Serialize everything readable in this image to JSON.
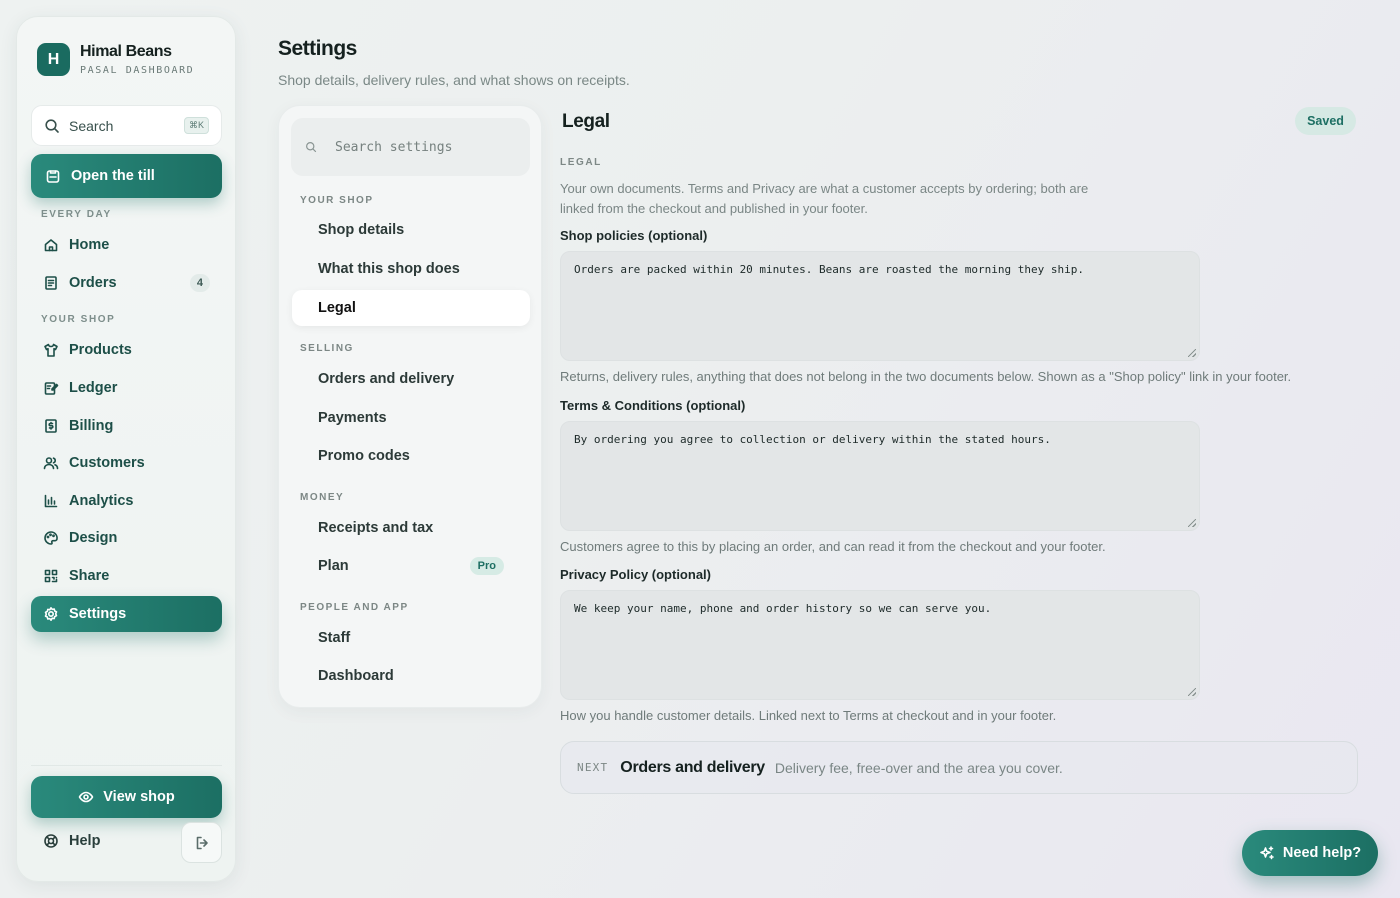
{
  "brand": {
    "logo_letter": "H",
    "name": "Himal Beans",
    "subtitle": "PASAL DASHBOARD"
  },
  "sidebar": {
    "search_label": "Search",
    "search_shortcut": "⌘K",
    "till_button": "Open the till",
    "section_everyday": "EVERY DAY",
    "section_shop": "YOUR SHOP",
    "items": [
      {
        "label": "Home",
        "icon": "home-icon"
      },
      {
        "label": "Orders",
        "icon": "receipt-icon",
        "badge": "4"
      },
      {
        "label": "Products",
        "icon": "shirt-icon"
      },
      {
        "label": "Ledger",
        "icon": "ledger-icon"
      },
      {
        "label": "Billing",
        "icon": "dollar-doc-icon"
      },
      {
        "label": "Customers",
        "icon": "users-icon"
      },
      {
        "label": "Analytics",
        "icon": "bar-chart-icon"
      },
      {
        "label": "Design",
        "icon": "palette-icon"
      },
      {
        "label": "Share",
        "icon": "qr-icon"
      },
      {
        "label": "Settings",
        "icon": "gear-icon",
        "active": true
      }
    ],
    "view_shop": "View shop",
    "help": "Help"
  },
  "header": {
    "title": "Settings",
    "subtitle": "Shop details, delivery rules, and what shows on receipts."
  },
  "settings_nav": {
    "search_placeholder": "Search settings",
    "sections": [
      {
        "label": "YOUR SHOP",
        "items": [
          "Shop details",
          "What this shop does",
          "Legal"
        ]
      },
      {
        "label": "SELLING",
        "items": [
          "Orders and delivery",
          "Payments",
          "Promo codes"
        ]
      },
      {
        "label": "MONEY",
        "items": [
          "Receipts and tax",
          "Plan"
        ]
      },
      {
        "label": "PEOPLE AND APP",
        "items": [
          "Staff",
          "Dashboard"
        ]
      }
    ],
    "active_item": "Legal",
    "plan_badge": "Pro"
  },
  "panel": {
    "title": "Legal",
    "status": "Saved",
    "caption": "LEGAL",
    "description": "Your own documents. Terms and Privacy are what a customer accepts by ordering; both are linked from the checkout and published in your footer.",
    "fields": [
      {
        "label": "Shop policies (optional)",
        "value": "Orders are packed within 20 minutes. Beans are roasted the morning they ship.",
        "help": "Returns, delivery rules, anything that does not belong in the two documents below. Shown as a \"Shop policy\" link in your footer."
      },
      {
        "label": "Terms & Conditions (optional)",
        "value": "By ordering you agree to collection or delivery within the stated hours.",
        "help": "Customers agree to this by placing an order, and can read it from the checkout and your footer."
      },
      {
        "label": "Privacy Policy (optional)",
        "value": "We keep your name, phone and order history so we can serve you.",
        "help": "How you handle customer details. Linked next to Terms at checkout and in your footer."
      }
    ],
    "next": {
      "tag": "NEXT",
      "title": "Orders and delivery",
      "description": "Delivery fee, free-over and the area you cover."
    }
  },
  "need_help": "Need help?",
  "colors": {
    "accent": "#1c6f63",
    "accent_light": "#2a8a7c",
    "badge_bg": "#d6e9e4"
  }
}
